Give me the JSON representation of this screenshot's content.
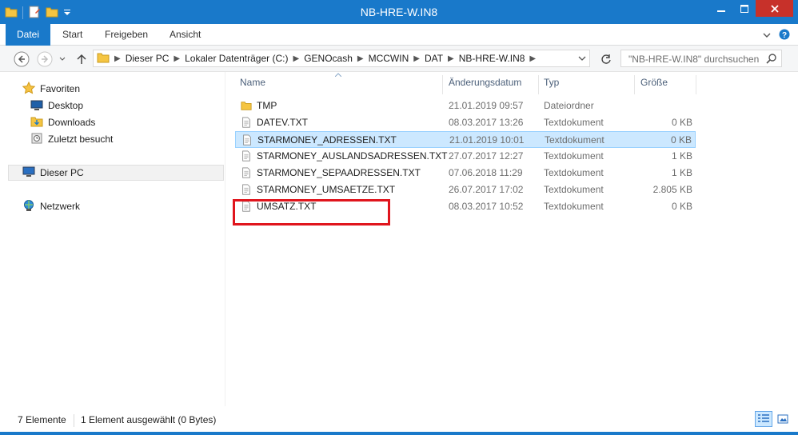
{
  "window": {
    "title": "NB-HRE-W.IN8"
  },
  "ribbon": {
    "tabs": [
      {
        "label": "Datei"
      },
      {
        "label": "Start"
      },
      {
        "label": "Freigeben"
      },
      {
        "label": "Ansicht"
      }
    ]
  },
  "breadcrumb": [
    "Dieser PC",
    "Lokaler Datenträger (C:)",
    "GENOcash",
    "MCCWIN",
    "DAT",
    "NB-HRE-W.IN8"
  ],
  "search": {
    "placeholder": "\"NB-HRE-W.IN8\" durchsuchen"
  },
  "navpane": {
    "favorites": "Favoriten",
    "desktop": "Desktop",
    "downloads": "Downloads",
    "recent": "Zuletzt besucht",
    "thispc": "Dieser PC",
    "network": "Netzwerk"
  },
  "columns": {
    "name": "Name",
    "date": "Änderungsdatum",
    "type": "Typ",
    "size": "Größe"
  },
  "files": [
    {
      "name": "TMP",
      "date": "21.01.2019 09:57",
      "type": "Dateiordner",
      "size": "",
      "kind": "folder"
    },
    {
      "name": "DATEV.TXT",
      "date": "08.03.2017 13:26",
      "type": "Textdokument",
      "size": "0 KB",
      "kind": "text"
    },
    {
      "name": "STARMONEY_ADRESSEN.TXT",
      "date": "21.01.2019 10:01",
      "type": "Textdokument",
      "size": "0 KB",
      "kind": "text",
      "selected": true
    },
    {
      "name": "STARMONEY_AUSLANDSADRESSEN.TXT",
      "date": "27.07.2017 12:27",
      "type": "Textdokument",
      "size": "1 KB",
      "kind": "text"
    },
    {
      "name": "STARMONEY_SEPAADRESSEN.TXT",
      "date": "07.06.2018 11:29",
      "type": "Textdokument",
      "size": "1 KB",
      "kind": "text"
    },
    {
      "name": "STARMONEY_UMSAETZE.TXT",
      "date": "26.07.2017 17:02",
      "type": "Textdokument",
      "size": "2.805 KB",
      "kind": "text"
    },
    {
      "name": "UMSATZ.TXT",
      "date": "08.03.2017 10:52",
      "type": "Textdokument",
      "size": "0 KB",
      "kind": "text"
    }
  ],
  "status": {
    "count": "7 Elemente",
    "selection": "1 Element ausgewählt (0 Bytes)"
  },
  "colors": {
    "accent": "#1979ca",
    "close": "#c7312a",
    "highlight": "#e0151d",
    "selected_row": "#cce8ff"
  }
}
